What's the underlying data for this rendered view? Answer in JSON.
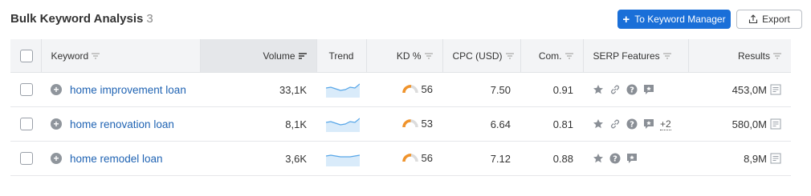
{
  "header": {
    "title": "Bulk Keyword Analysis",
    "count": "3",
    "primary_button_label": "To Keyword Manager",
    "export_label": "Export"
  },
  "columns": {
    "keyword": "Keyword",
    "volume": "Volume",
    "trend": "Trend",
    "kd": "KD %",
    "cpc": "CPC (USD)",
    "com": "Com.",
    "serp": "SERP Features",
    "results": "Results"
  },
  "rows": [
    {
      "keyword": "home improvement loan",
      "volume": "33,1K",
      "kd": "56",
      "cpc": "7.50",
      "com": "0.91",
      "serp_more": "",
      "results": "453,0M"
    },
    {
      "keyword": "home renovation loan",
      "volume": "8,1K",
      "kd": "53",
      "cpc": "6.64",
      "com": "0.81",
      "serp_more": "+2",
      "results": "580,0M"
    },
    {
      "keyword": "home remodel loan",
      "volume": "3,6K",
      "kd": "56",
      "cpc": "7.12",
      "com": "0.88",
      "serp_more": "",
      "results": "8,9M"
    }
  ],
  "colors": {
    "primary": "#1a6fd8",
    "link": "#1f63b3",
    "kd_arc": "#f0932b",
    "trend_line": "#57a6e8",
    "trend_fill": "#d9ebfa"
  },
  "icons": {
    "serp_row_1": [
      "star-icon",
      "link-icon",
      "question-icon",
      "review-icon"
    ],
    "serp_row_2": [
      "star-icon",
      "link-icon",
      "question-icon",
      "review-icon"
    ],
    "serp_row_3": [
      "star-icon",
      "question-icon",
      "review-icon"
    ]
  }
}
